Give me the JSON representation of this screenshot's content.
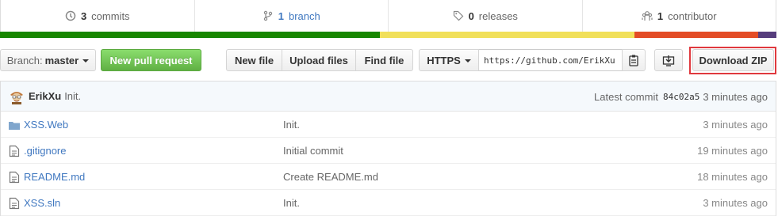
{
  "summary": {
    "commits": {
      "count": "3",
      "label": "commits"
    },
    "branches": {
      "count": "1",
      "label": "branch"
    },
    "releases": {
      "count": "0",
      "label": "releases"
    },
    "contributors": {
      "count": "1",
      "label": "contributor"
    }
  },
  "language_bar": [
    {
      "color": "#178600",
      "share": 0.489
    },
    {
      "color": "#f1e05a",
      "share": 0.328
    },
    {
      "color": "#e34c26",
      "share": 0.16
    },
    {
      "color": "#563d7c",
      "share": 0.023
    }
  ],
  "toolbar": {
    "branch_prefix": "Branch:",
    "branch_name": "master",
    "new_pull_request": "New pull request",
    "new_file": "New file",
    "upload_files": "Upload files",
    "find_file": "Find file",
    "protocol": "HTTPS",
    "clone_url": "https://github.com/ErikXu",
    "download_zip": "Download ZIP"
  },
  "latest_commit": {
    "author": "ErikXu",
    "message": "Init.",
    "label": "Latest commit",
    "sha": "84c02a5",
    "age": "3 minutes ago"
  },
  "files": [
    {
      "type": "folder",
      "name": "XSS.Web",
      "message": "Init.",
      "age": "3 minutes ago"
    },
    {
      "type": "file",
      "name": ".gitignore",
      "message": "Initial commit",
      "age": "19 minutes ago"
    },
    {
      "type": "file",
      "name": "README.md",
      "message": "Create README.md",
      "age": "18 minutes ago"
    },
    {
      "type": "file",
      "name": "XSS.sln",
      "message": "Init.",
      "age": "3 minutes ago"
    }
  ]
}
